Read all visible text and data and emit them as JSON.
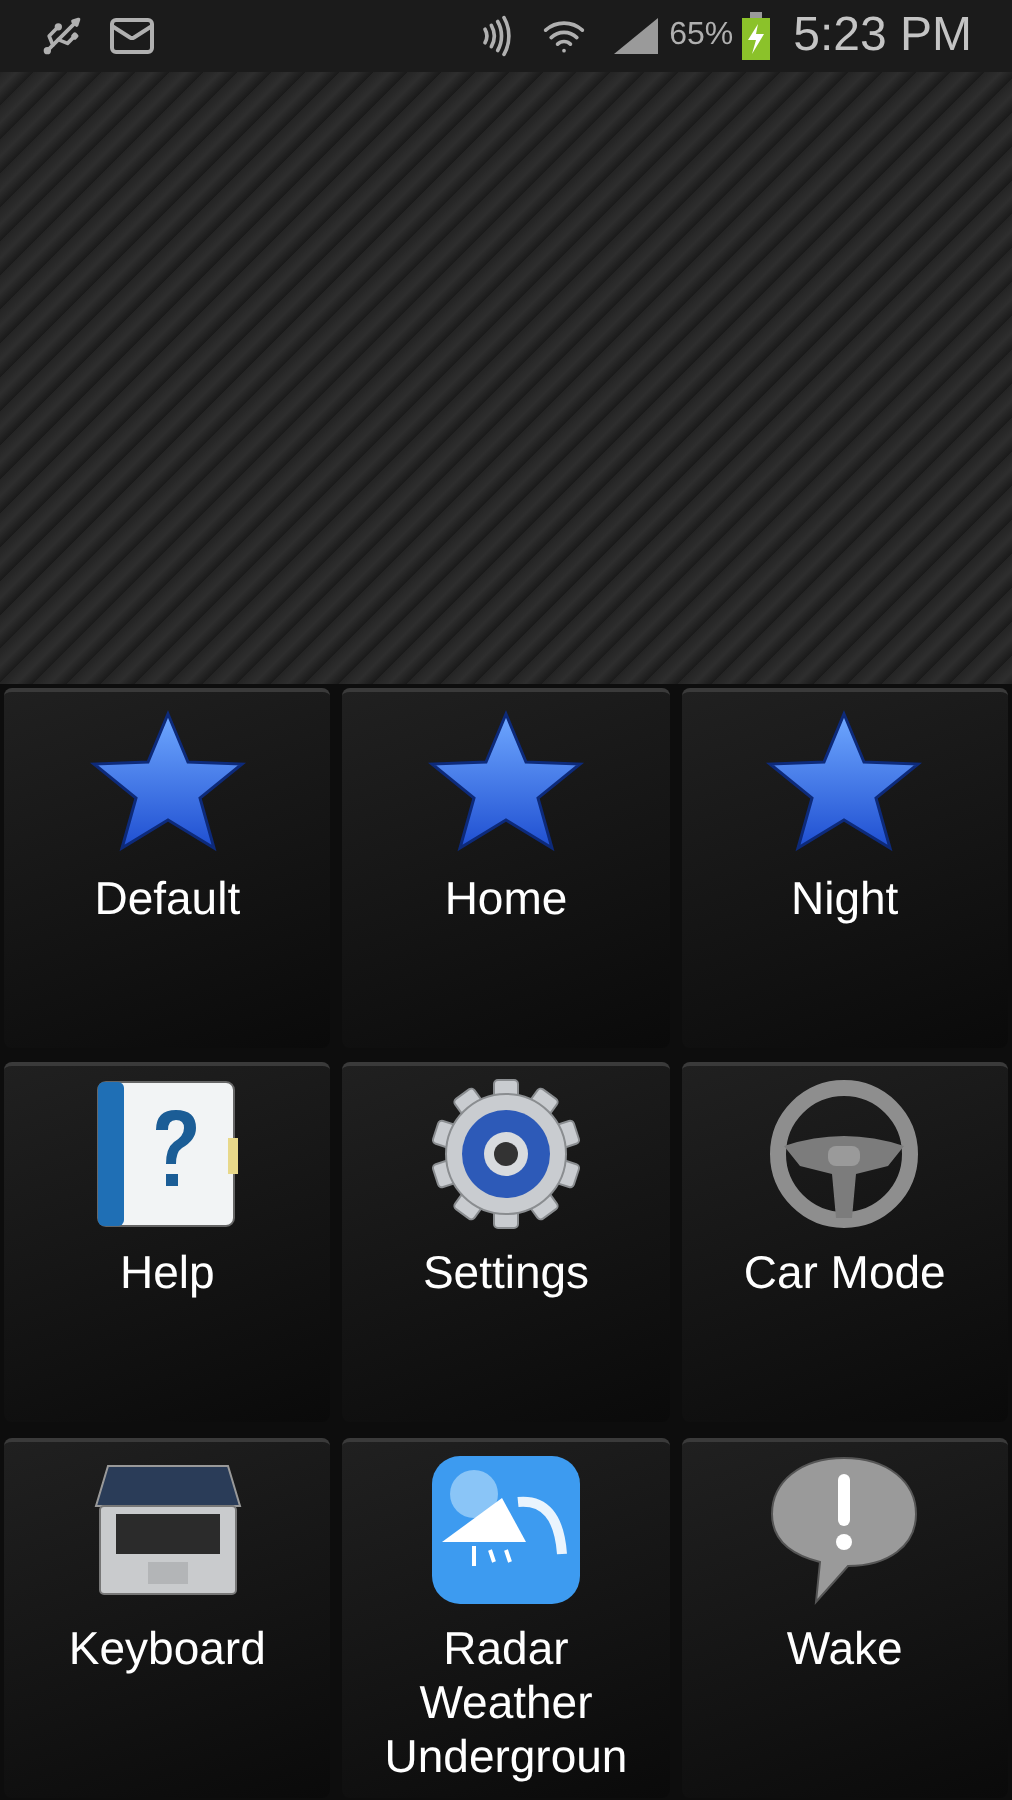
{
  "status_bar": {
    "battery": "65%",
    "time": "5:23 PM"
  },
  "tiles": [
    {
      "label": "Default"
    },
    {
      "label": "Home"
    },
    {
      "label": "Night"
    },
    {
      "label": "Help"
    },
    {
      "label": "Settings"
    },
    {
      "label": "Car Mode"
    },
    {
      "label": "Keyboard"
    },
    {
      "label": "Radar Weather Undergroun"
    },
    {
      "label": "Wake"
    }
  ]
}
